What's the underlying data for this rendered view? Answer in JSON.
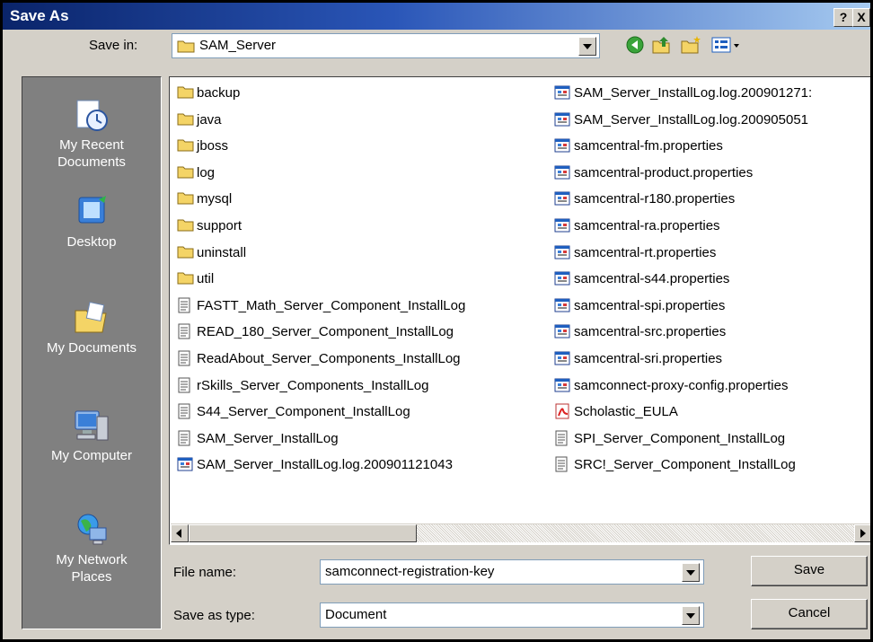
{
  "window": {
    "title": "Save As",
    "help_label": "?",
    "close_label": "X"
  },
  "toolbar": {
    "save_in_label": "Save in:",
    "save_in_value": "SAM_Server",
    "icons": [
      "back-icon",
      "up-folder-icon",
      "new-folder-icon",
      "views-menu-icon"
    ]
  },
  "places": [
    {
      "label": "My Recent\nDocuments",
      "icon": "recent-documents-icon"
    },
    {
      "label": "Desktop",
      "icon": "desktop-icon"
    },
    {
      "label": "My Documents",
      "icon": "my-documents-icon"
    },
    {
      "label": "My Computer",
      "icon": "my-computer-icon"
    },
    {
      "label": "My Network\nPlaces",
      "icon": "network-places-icon"
    }
  ],
  "files": {
    "column1": [
      {
        "name": "backup",
        "type": "folder"
      },
      {
        "name": "java",
        "type": "folder"
      },
      {
        "name": "jboss",
        "type": "folder"
      },
      {
        "name": "log",
        "type": "folder"
      },
      {
        "name": "mysql",
        "type": "folder"
      },
      {
        "name": "support",
        "type": "folder"
      },
      {
        "name": "uninstall",
        "type": "folder"
      },
      {
        "name": "util",
        "type": "folder"
      },
      {
        "name": "FASTT_Math_Server_Component_InstallLog",
        "type": "text"
      },
      {
        "name": "READ_180_Server_Component_InstallLog",
        "type": "text"
      },
      {
        "name": "ReadAbout_Server_Components_InstallLog",
        "type": "text"
      },
      {
        "name": "rSkills_Server_Components_InstallLog",
        "type": "text"
      },
      {
        "name": "S44_Server_Component_InstallLog",
        "type": "text"
      },
      {
        "name": "SAM_Server_InstallLog",
        "type": "text"
      },
      {
        "name": "SAM_Server_InstallLog.log.200901121043",
        "type": "config"
      }
    ],
    "column2": [
      {
        "name": "SAM_Server_InstallLog.log.200901271:",
        "type": "config"
      },
      {
        "name": "SAM_Server_InstallLog.log.200905051",
        "type": "config"
      },
      {
        "name": "samcentral-fm.properties",
        "type": "config"
      },
      {
        "name": "samcentral-product.properties",
        "type": "config"
      },
      {
        "name": "samcentral-r180.properties",
        "type": "config"
      },
      {
        "name": "samcentral-ra.properties",
        "type": "config"
      },
      {
        "name": "samcentral-rt.properties",
        "type": "config"
      },
      {
        "name": "samcentral-s44.properties",
        "type": "config"
      },
      {
        "name": "samcentral-spi.properties",
        "type": "config"
      },
      {
        "name": "samcentral-src.properties",
        "type": "config"
      },
      {
        "name": "samcentral-sri.properties",
        "type": "config"
      },
      {
        "name": "samconnect-proxy-config.properties",
        "type": "config"
      },
      {
        "name": "Scholastic_EULA",
        "type": "pdf"
      },
      {
        "name": "SPI_Server_Component_InstallLog",
        "type": "text"
      },
      {
        "name": "SRC!_Server_Component_InstallLog",
        "type": "text"
      }
    ]
  },
  "form": {
    "file_name_label": "File name:",
    "file_name_value": "samconnect-registration-key",
    "save_as_type_label": "Save as type:",
    "save_as_type_value": "Document",
    "save_button": "Save",
    "cancel_button": "Cancel"
  },
  "colors": {
    "title_bar_start": "#0a246a",
    "title_bar_end": "#a6caf0",
    "dialog_face": "#d4d0c8",
    "places_bar": "#808080",
    "folder_yellow": "#f4d466"
  }
}
